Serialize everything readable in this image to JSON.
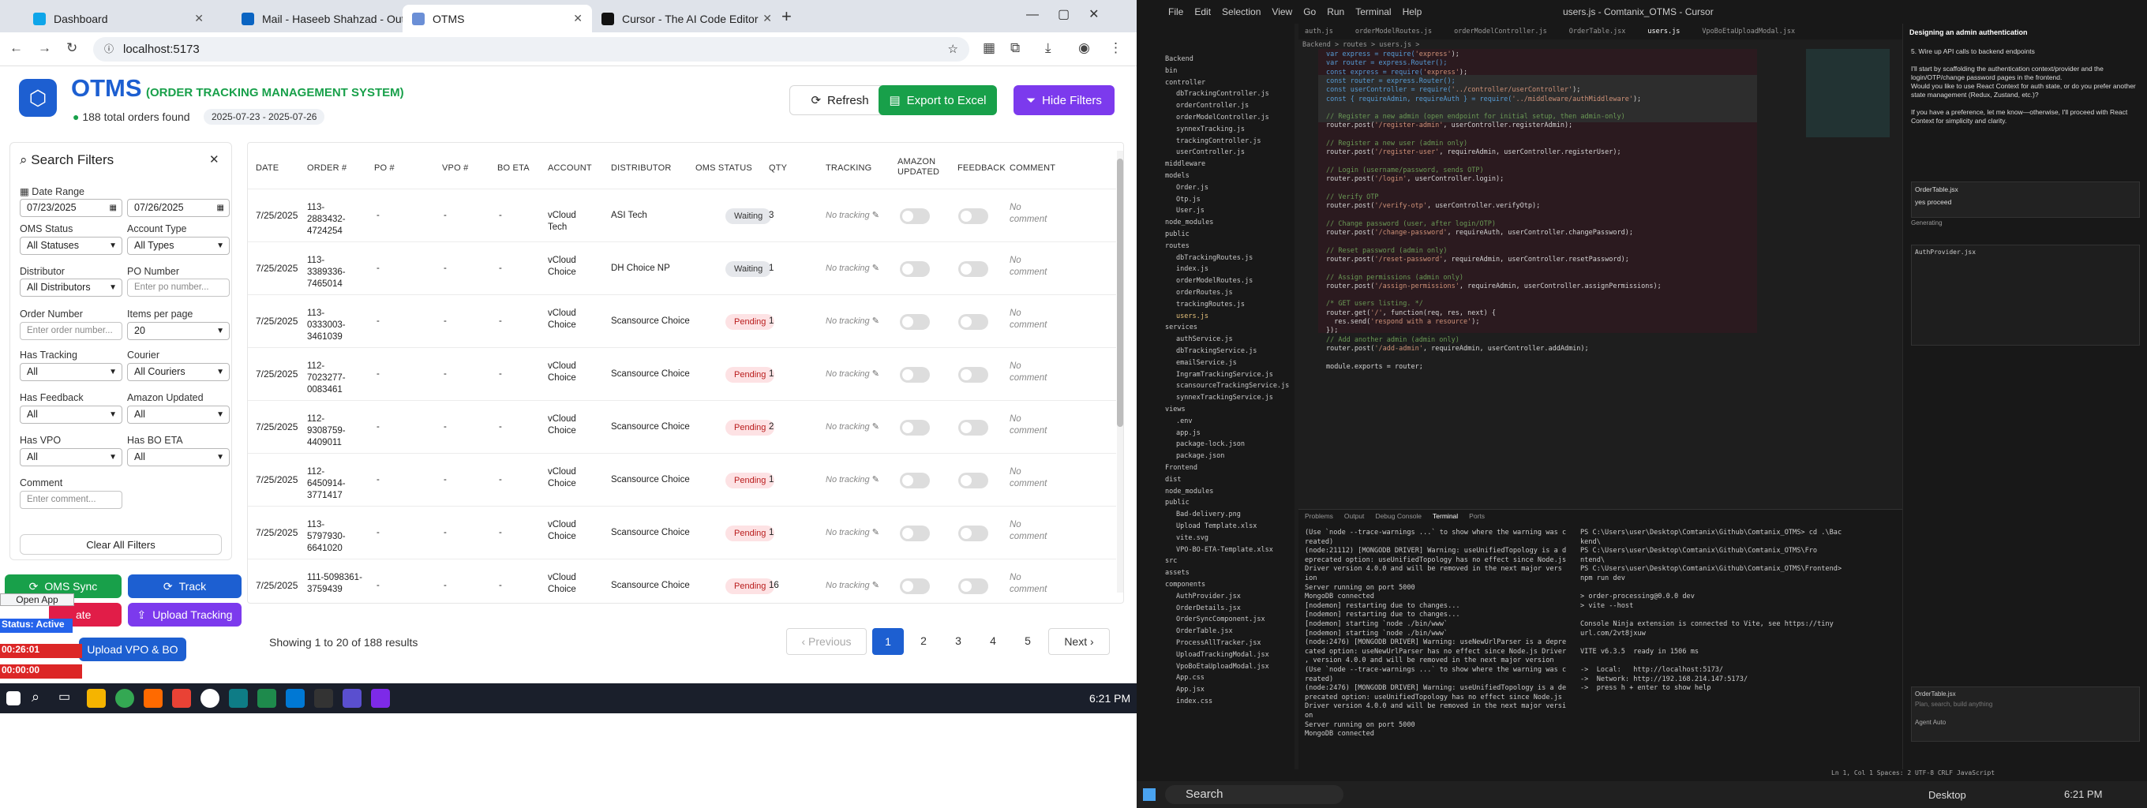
{
  "browser": {
    "tabs": [
      {
        "label": "Dashboard"
      },
      {
        "label": "Mail - Haseeb Shahzad - Outlo"
      },
      {
        "label": "OTMS"
      },
      {
        "label": "Cursor - The AI Code Editor"
      }
    ],
    "url": "localhost:5173"
  },
  "app": {
    "title": "OTMS",
    "subtitle": "(ORDER TRACKING MANAGEMENT SYSTEM)",
    "orders_found": "188 total orders found",
    "date_range": "2025-07-23 - 2025-07-26",
    "refresh": "Refresh",
    "export": "Export to Excel",
    "hide_filters": "Hide Filters"
  },
  "filters": {
    "title": "Search Filters",
    "date_range_label": "Date Range",
    "date_from": "07/23/2025",
    "date_to": "07/26/2025",
    "oms_status_label": "OMS Status",
    "oms_status": "All Statuses",
    "account_type_label": "Account Type",
    "account_type": "All Types",
    "distributor_label": "Distributor",
    "distributor": "All Distributors",
    "po_number_label": "PO Number",
    "po_placeholder": "Enter po number...",
    "order_number_label": "Order Number",
    "order_placeholder": "Enter order number...",
    "items_per_page_label": "Items per page",
    "items_per_page": "20",
    "has_tracking_label": "Has Tracking",
    "has_tracking": "All",
    "courier_label": "Courier",
    "courier": "All Couriers",
    "has_feedback_label": "Has Feedback",
    "has_feedback": "All",
    "amazon_updated_label": "Amazon Updated",
    "amazon_updated": "All",
    "has_vpo_label": "Has VPO",
    "has_vpo": "All",
    "has_bo_eta_label": "Has BO ETA",
    "has_bo_eta": "All",
    "comment_label": "Comment",
    "comment_placeholder": "Enter comment...",
    "clear": "Clear All Filters"
  },
  "actions": {
    "oms_sync": "OMS Sync",
    "track": "Track",
    "upload_tracking": "Upload Tracking",
    "upload_vpo": "Upload VPO & BO",
    "create": "ate",
    "open_app": "Open App",
    "status_active": "Status: Active",
    "timer1": "00:26:01",
    "timer2": "00:00:00"
  },
  "table": {
    "headers": [
      "DATE",
      "ORDER #",
      "PO #",
      "VPO #",
      "BO ETA",
      "ACCOUNT",
      "DISTRIBUTOR",
      "OMS STATUS",
      "QTY",
      "TRACKING",
      "AMAZON UPDATED",
      "FEEDBACK",
      "COMMENT"
    ],
    "no_tracking": "No tracking",
    "no_comment": "No comment",
    "rows": [
      {
        "date": "7/25/2025",
        "order": "113-2883432-4724254",
        "po": "-",
        "vpo": "-",
        "account": "vCloud Tech",
        "distributor": "ASI Tech",
        "status": "Waiting",
        "qty": "3"
      },
      {
        "date": "7/25/2025",
        "order": "113-3389336-7465014",
        "po": "-",
        "vpo": "-",
        "account": "vCloud Choice",
        "distributor": "DH Choice NP",
        "status": "Waiting",
        "qty": "1"
      },
      {
        "date": "7/25/2025",
        "order": "113-0333003-3461039",
        "po": "-",
        "vpo": "-",
        "account": "vCloud Choice",
        "distributor": "Scansource Choice",
        "status": "Pending",
        "qty": "1"
      },
      {
        "date": "7/25/2025",
        "order": "112-7023277-0083461",
        "po": "-",
        "vpo": "-",
        "account": "vCloud Choice",
        "distributor": "Scansource Choice",
        "status": "Pending",
        "qty": "1"
      },
      {
        "date": "7/25/2025",
        "order": "112-9308759-4409011",
        "po": "-",
        "vpo": "-",
        "account": "vCloud Choice",
        "distributor": "Scansource Choice",
        "status": "Pending",
        "qty": "2"
      },
      {
        "date": "7/25/2025",
        "order": "112-6450914-3771417",
        "po": "-",
        "vpo": "-",
        "account": "vCloud Choice",
        "distributor": "Scansource Choice",
        "status": "Pending",
        "qty": "1"
      },
      {
        "date": "7/25/2025",
        "order": "113-5797930-6641020",
        "po": "-",
        "vpo": "-",
        "account": "vCloud Choice",
        "distributor": "Scansource Choice",
        "status": "Pending",
        "qty": "1"
      },
      {
        "date": "7/25/2025",
        "order": "111-5098361-3759439",
        "po": "-",
        "vpo": "-",
        "account": "vCloud Choice",
        "distributor": "Scansource Choice",
        "status": "Pending",
        "qty": "16"
      }
    ]
  },
  "pagination": {
    "showing": "Showing 1 to 20 of 188 results",
    "previous": "Previous",
    "pages": [
      "1",
      "2",
      "3",
      "4",
      "5"
    ],
    "next": "Next"
  },
  "taskbar": {
    "time": "6:21 PM"
  },
  "editor": {
    "title": "users.js - Comtanix_OTMS - Cursor",
    "menu": [
      "File",
      "Edit",
      "Selection",
      "View",
      "Go",
      "Run",
      "Terminal",
      "Help"
    ],
    "tabs": [
      "auth.js",
      "orderModelRoutes.js",
      "orderModelController.js",
      "OrderTable.jsx",
      "users.js",
      "VpoBoEtaUploadModal.jsx"
    ],
    "breadcrumb": "Backend > routes > users.js >",
    "code": [
      "var express = require('express');",
      "var router = express.Router();",
      "const express = require('express');",
      "const router = express.Router();",
      "const userController = require('../controller/userController');",
      "const { requireAdmin, requireAuth } = require('../middleware/authMiddleware');",
      "",
      "// Register a new admin (open endpoint for initial setup, then admin-only)",
      "router.post('/register-admin', userController.registerAdmin);",
      "",
      "// Register a new user (admin only)",
      "router.post('/register-user', requireAdmin, userController.registerUser);",
      "",
      "// Login (username/password, sends OTP)",
      "router.post('/login', userController.login);",
      "",
      "// Verify OTP",
      "router.post('/verify-otp', userController.verifyOtp);",
      "",
      "// Change password (user, after login/OTP)",
      "router.post('/change-password', requireAuth, userController.changePassword);",
      "",
      "// Reset password (admin only)",
      "router.post('/reset-password', requireAdmin, userController.resetPassword);",
      "",
      "// Assign permissions (admin only)",
      "router.post('/assign-permissions', requireAdmin, userController.assignPermissions);",
      "",
      "/* GET users listing. */",
      "router.get('/', function(req, res, next) {",
      "  res.send('respond with a resource');",
      "});",
      "// Add another admin (admin only)",
      "router.post('/add-admin', requireAdmin, userController.addAdmin);",
      "",
      "module.exports = router;"
    ],
    "tree": [
      "Backend",
      "bin",
      "controller",
      "dbTrackingController.js",
      "orderController.js",
      "orderModelController.js",
      "synnexTracking.js",
      "trackingController.js",
      "userController.js",
      "middleware",
      "models",
      "Order.js",
      "Otp.js",
      "User.js",
      "node_modules",
      "public",
      "routes",
      "dbTrackingRoutes.js",
      "index.js",
      "orderModelRoutes.js",
      "orderRoutes.js",
      "trackingRoutes.js",
      "users.js",
      "services",
      "authService.js",
      "dbTrackingService.js",
      "emailService.js",
      "IngramTrackingService.js",
      "scansourceTrackingService.js",
      "synnexTrackingService.js",
      "views",
      ".env",
      "app.js",
      "package-lock.json",
      "package.json",
      "Frontend",
      "dist",
      "node_modules",
      "public",
      "Bad-delivery.png",
      "Upload Template.xlsx",
      "vite.svg",
      "VPO-BO-ETA-Template.xlsx",
      "src",
      "assets",
      "components",
      "AuthProvider.jsx",
      "OrderDetails.jsx",
      "OrderSyncComponent.jsx",
      "OrderTable.jsx",
      "ProcessAllTracker.jsx",
      "UploadTrackingModal.jsx",
      "VpoBoEtaUploadModal.jsx",
      "App.css",
      "App.jsx",
      "index.css"
    ],
    "panel_tabs": [
      "Problems",
      "Output",
      "Debug Console",
      "Terminal",
      "Ports"
    ],
    "term_left": [
      "(Use `node --trace-warnings ...` to show where the warning was c",
      "reated)",
      "(node:21112) [MONGODB DRIVER] Warning: useUnifiedTopology is a d",
      "eprecated option: useUnifiedTopology has no effect since Node.js",
      "Driver version 4.0.0 and will be removed in the next major vers",
      "ion",
      "Server running on port 5000",
      "MongoDB connected",
      "[nodemon] restarting due to changes...",
      "[nodemon] restarting due to changes...",
      "[nodemon] starting `node ./bin/www`",
      "[nodemon] starting `node ./bin/www`",
      "(node:2476) [MONGODB DRIVER] Warning: useNewUrlParser is a depre",
      "cated option: useNewUrlParser has no effect since Node.js Driver",
      ", version 4.0.0 and will be removed in the next major version",
      "(Use `node --trace-warnings ...` to show where the warning was c",
      "reated)",
      "(node:2476) [MONGODB DRIVER] Warning: useUnifiedTopology is a de",
      "precated option: useUnifiedTopology has no effect since Node.js",
      "Driver version 4.0.0 and will be removed in the next major versi",
      "on",
      "Server running on port 5000",
      "MongoDB connected"
    ],
    "term_right": [
      "PS C:\\Users\\user\\Desktop\\Comtanix\\Github\\Comtanix_OTMS> cd .\\Bac",
      "kend\\",
      "PS C:\\Users\\user\\Desktop\\Comtanix\\Github\\Comtanix_OTMS\\Fro",
      "ntend\\",
      "PS C:\\Users\\user\\Desktop\\Comtanix\\Github\\Comtanix_OTMS\\Frontend>",
      "npm run dev",
      "",
      "> order-processing@0.0.0 dev",
      "> vite --host",
      "",
      "Console Ninja extension is connected to Vite, see https://tiny",
      "url.com/2vt8jxuw",
      "",
      "VITE v6.3.5  ready in 1506 ms",
      "",
      "->  Local:   http://localhost:5173/",
      "->  Network: http://192.168.214.147:5173/",
      "->  press h + enter to show help"
    ],
    "chat": {
      "step": "5. Wire up API calls to backend endpoints",
      "p1": "I'll start by scaffolding the authentication context/provider and the login/OTP/change password pages in the frontend.",
      "p2": "Would you like to use React Context for auth state, or do you prefer another state management (Redux, Zustand, etc.)?",
      "p3": "If you have a preference, let me know—otherwise, I'll proceed with React Context for simplicity and clarity.",
      "file1": "OrderTable.jsx",
      "yes": "yes proceed",
      "generating": "Generating",
      "file2": "AuthProvider.jsx",
      "file3": "OrderTable.jsx",
      "placeholder": "Plan, search, build anything",
      "agent": "Agent",
      "auto": "Auto",
      "header": "Designing an admin authentication"
    },
    "status": "Ln 1, Col 1  Spaces: 2  UTF-8  CRLF  JavaScript",
    "clock": "6:21 PM",
    "search": "Search",
    "desktop": "Desktop"
  },
  "colors": {
    "blue": "#1d5fd1",
    "green": "#18a04a",
    "purple": "#7c3aed",
    "red": "#e11d48",
    "waiting_bg": "#e5e7eb",
    "pending_bg": "#fde2e4"
  }
}
